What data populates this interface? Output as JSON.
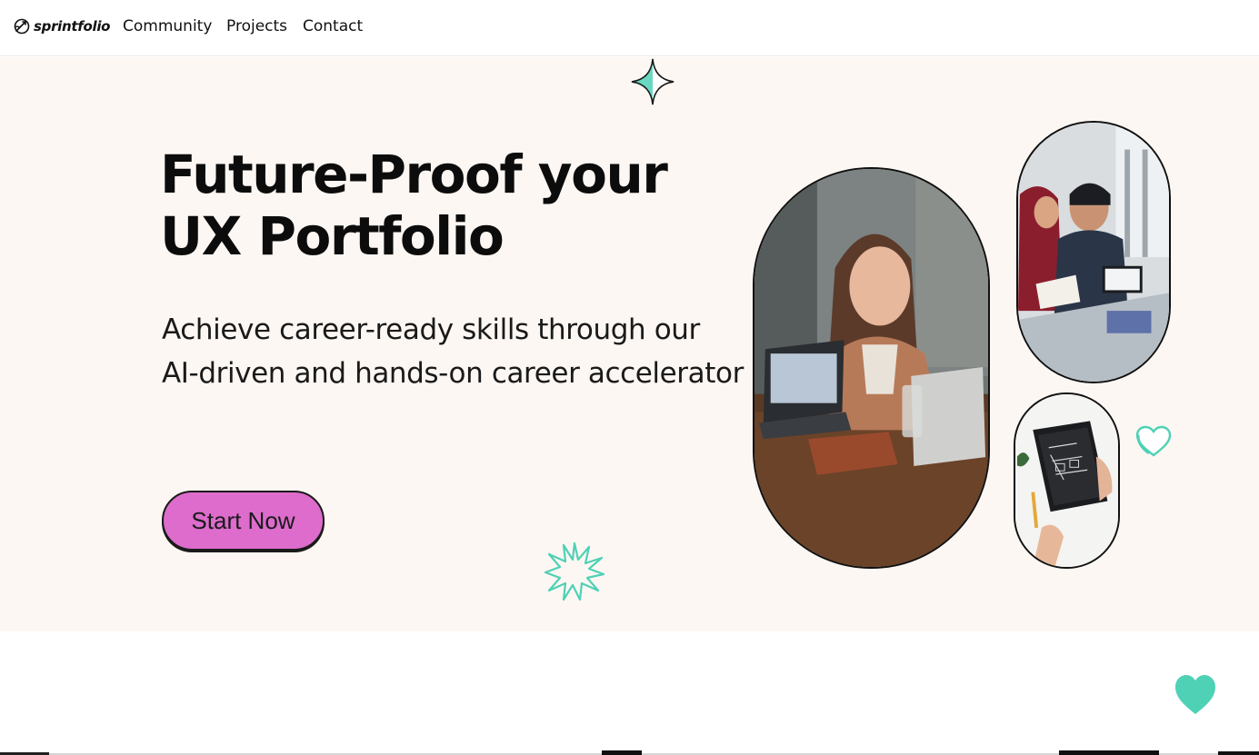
{
  "nav": {
    "logo_text": "sprintfolio",
    "links": [
      "Community",
      "Projects",
      "Contact"
    ]
  },
  "hero": {
    "headline_line1": "Future-Proof your",
    "headline_line2": "UX Portfolio",
    "subtext": "Achieve career-ready skills through our AI-driven and hands-on career accelerator",
    "cta_label": "Start Now"
  },
  "icons": {
    "logo": "rocket-logo-icon",
    "sparkle": "four-point-sparkle-icon",
    "starburst": "starburst-icon",
    "heart_outline": "heart-outline-icon",
    "heart_fab": "heart-icon"
  },
  "colors": {
    "hero_background": "#fdf7f3",
    "cta_background": "#dd6ccc",
    "accent_teal": "#4fd1b5",
    "text": "#0c0c0c"
  }
}
